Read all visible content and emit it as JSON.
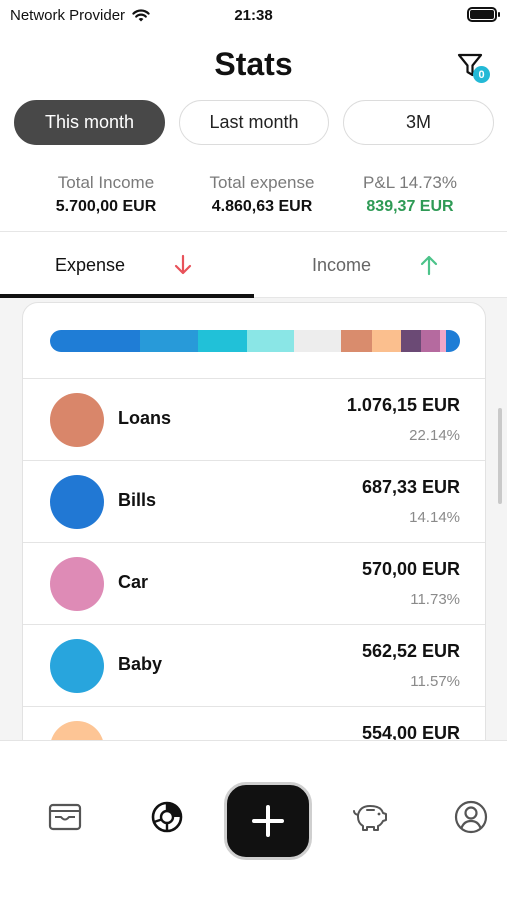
{
  "status_bar": {
    "carrier": "Network Provider",
    "time": "21:38",
    "icons": [
      "wifi-icon",
      "battery-icon"
    ]
  },
  "header": {
    "title": "Stats",
    "filter_icon": "filter-icon",
    "filter_badge": "0"
  },
  "periods": [
    {
      "label": "This month",
      "active": true
    },
    {
      "label": "Last month",
      "active": false
    },
    {
      "label": "3M",
      "active": false
    }
  ],
  "summary": {
    "total_income_label": "Total Income",
    "total_income_value": "5.700,00 EUR",
    "total_expense_label": "Total expense",
    "total_expense_value": "4.860,63 EUR",
    "pl_label": "P&L 14.73%",
    "pl_value": "839,37 EUR",
    "pl_color": "#2e9a55"
  },
  "tabs": [
    {
      "label": "Expense",
      "icon": "arrow-down-icon",
      "icon_color": "#e8525a",
      "active": true
    },
    {
      "label": "Income",
      "icon": "arrow-up-icon",
      "icon_color": "#4cc38a",
      "active": false
    }
  ],
  "breakdown_bar": {
    "segments": [
      {
        "color": "#1f7dd6",
        "fraction": 0.22
      },
      {
        "color": "#289ad9",
        "fraction": 0.14
      },
      {
        "color": "#21c1d8",
        "fraction": 0.12
      },
      {
        "color": "#8ae6e6",
        "fraction": 0.115
      },
      {
        "color": "#ededed",
        "fraction": 0.115
      },
      {
        "color": "#d98c6d",
        "fraction": 0.075
      },
      {
        "color": "#fbbf8e",
        "fraction": 0.07
      },
      {
        "color": "#6b4a75",
        "fraction": 0.05
      },
      {
        "color": "#b56a9f",
        "fraction": 0.045
      },
      {
        "color": "#f0a7c8",
        "fraction": 0.015
      },
      {
        "color": "#1f7dd6",
        "fraction": 0.035
      }
    ]
  },
  "categories": [
    {
      "name": "Loans",
      "amount": "1.076,15 EUR",
      "percent": "22.14%",
      "color": "#d9866a"
    },
    {
      "name": "Bills",
      "amount": "687,33 EUR",
      "percent": "14.14%",
      "color": "#2178d4"
    },
    {
      "name": "Car",
      "amount": "570,00 EUR",
      "percent": "11.73%",
      "color": "#de8bb6"
    },
    {
      "name": "Baby",
      "amount": "562,52 EUR",
      "percent": "11.57%",
      "color": "#28a5dd"
    },
    {
      "name": "",
      "amount": "554,00 EUR",
      "percent": "",
      "color": "#fdc595"
    }
  ],
  "bottom_nav": {
    "items": [
      "wallet-icon",
      "stats-chart-icon",
      "add-icon",
      "piggy-bank-icon",
      "profile-icon"
    ]
  }
}
